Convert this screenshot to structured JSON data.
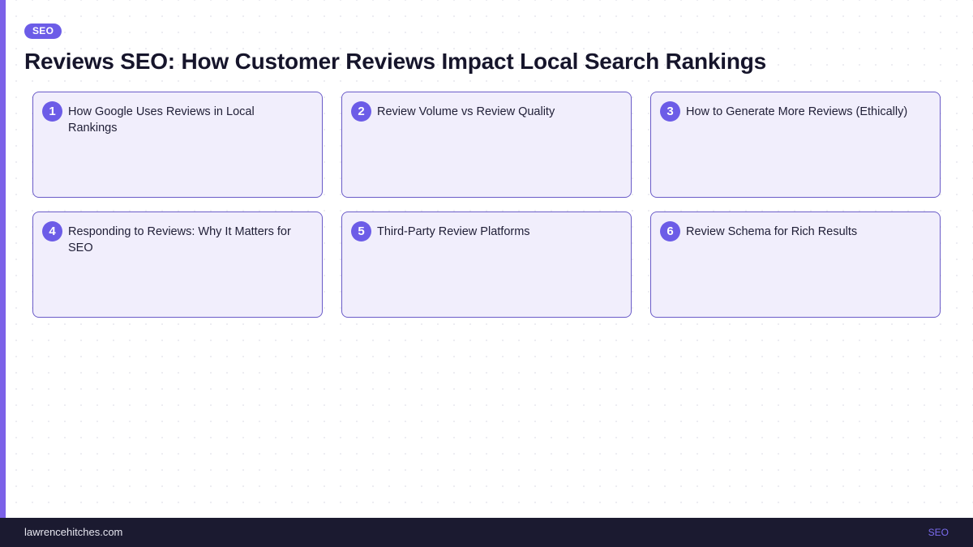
{
  "tag": "SEO",
  "title": "Reviews SEO: How Customer Reviews Impact Local Search Rankings",
  "cards": [
    {
      "number": "1",
      "title": "How Google Uses Reviews in Local Rankings"
    },
    {
      "number": "2",
      "title": "Review Volume vs Review Quality"
    },
    {
      "number": "3",
      "title": "How to Generate More Reviews (Ethically)"
    },
    {
      "number": "4",
      "title": "Responding to Reviews: Why It Matters for SEO"
    },
    {
      "number": "5",
      "title": "Third-Party Review Platforms"
    },
    {
      "number": "6",
      "title": "Review Schema for Rich Results"
    }
  ],
  "footer": {
    "site": "lawrencehitches.com",
    "tag": "SEO"
  },
  "colors": {
    "accent": "#6c5ce7",
    "card_background": "#f1eefc",
    "footer_background": "#1b1a30"
  }
}
